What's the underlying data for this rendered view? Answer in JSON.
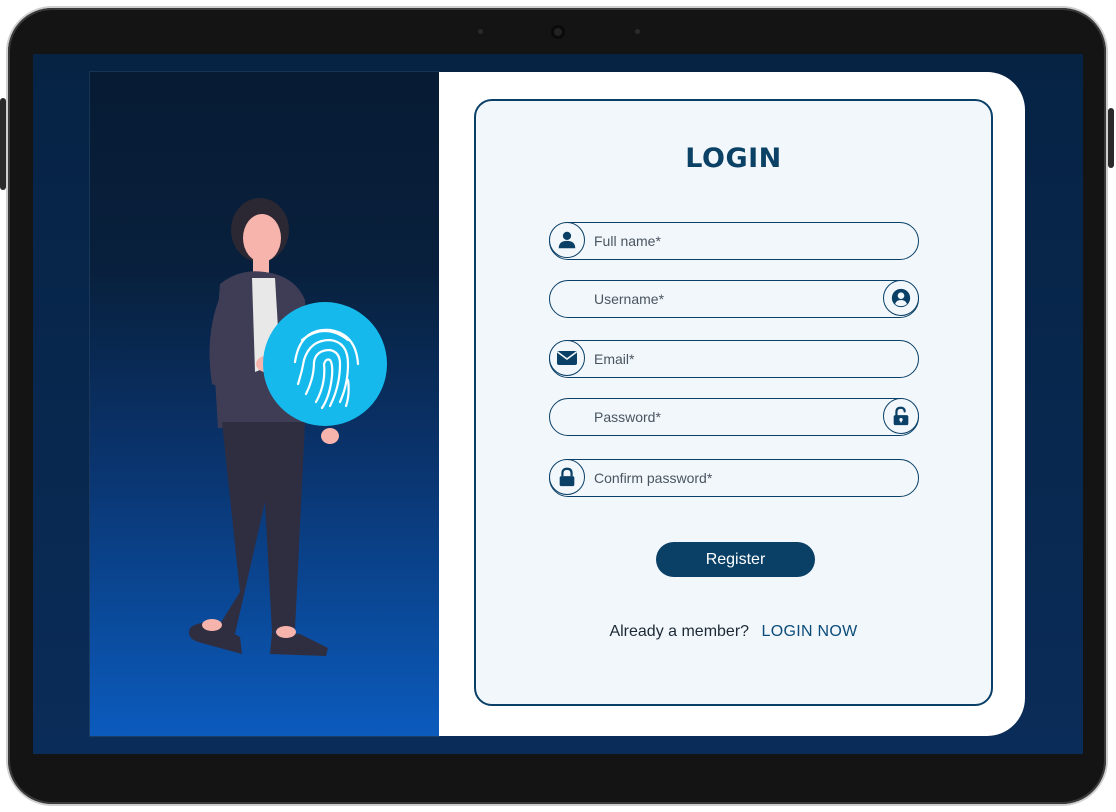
{
  "login_form": {
    "title": "LOGIN",
    "fields": [
      {
        "placeholder": "Full name*",
        "icon": "user-icon"
      },
      {
        "placeholder": "Username*",
        "icon": "user-circle-icon"
      },
      {
        "placeholder": "Email*",
        "icon": "envelope-icon"
      },
      {
        "placeholder": "Password*",
        "icon": "unlock-icon"
      },
      {
        "placeholder": "Confirm password*",
        "icon": "lock-icon"
      }
    ],
    "register_label": "Register",
    "member_text": "Already a member?",
    "login_link": "LOGIN NOW"
  },
  "illustration": {
    "icon": "fingerprint-icon",
    "accent_color": "#16b9ec"
  },
  "colors": {
    "primary": "#0b4066",
    "card_background": "#f2f7fb",
    "screen_background": "#062344"
  }
}
